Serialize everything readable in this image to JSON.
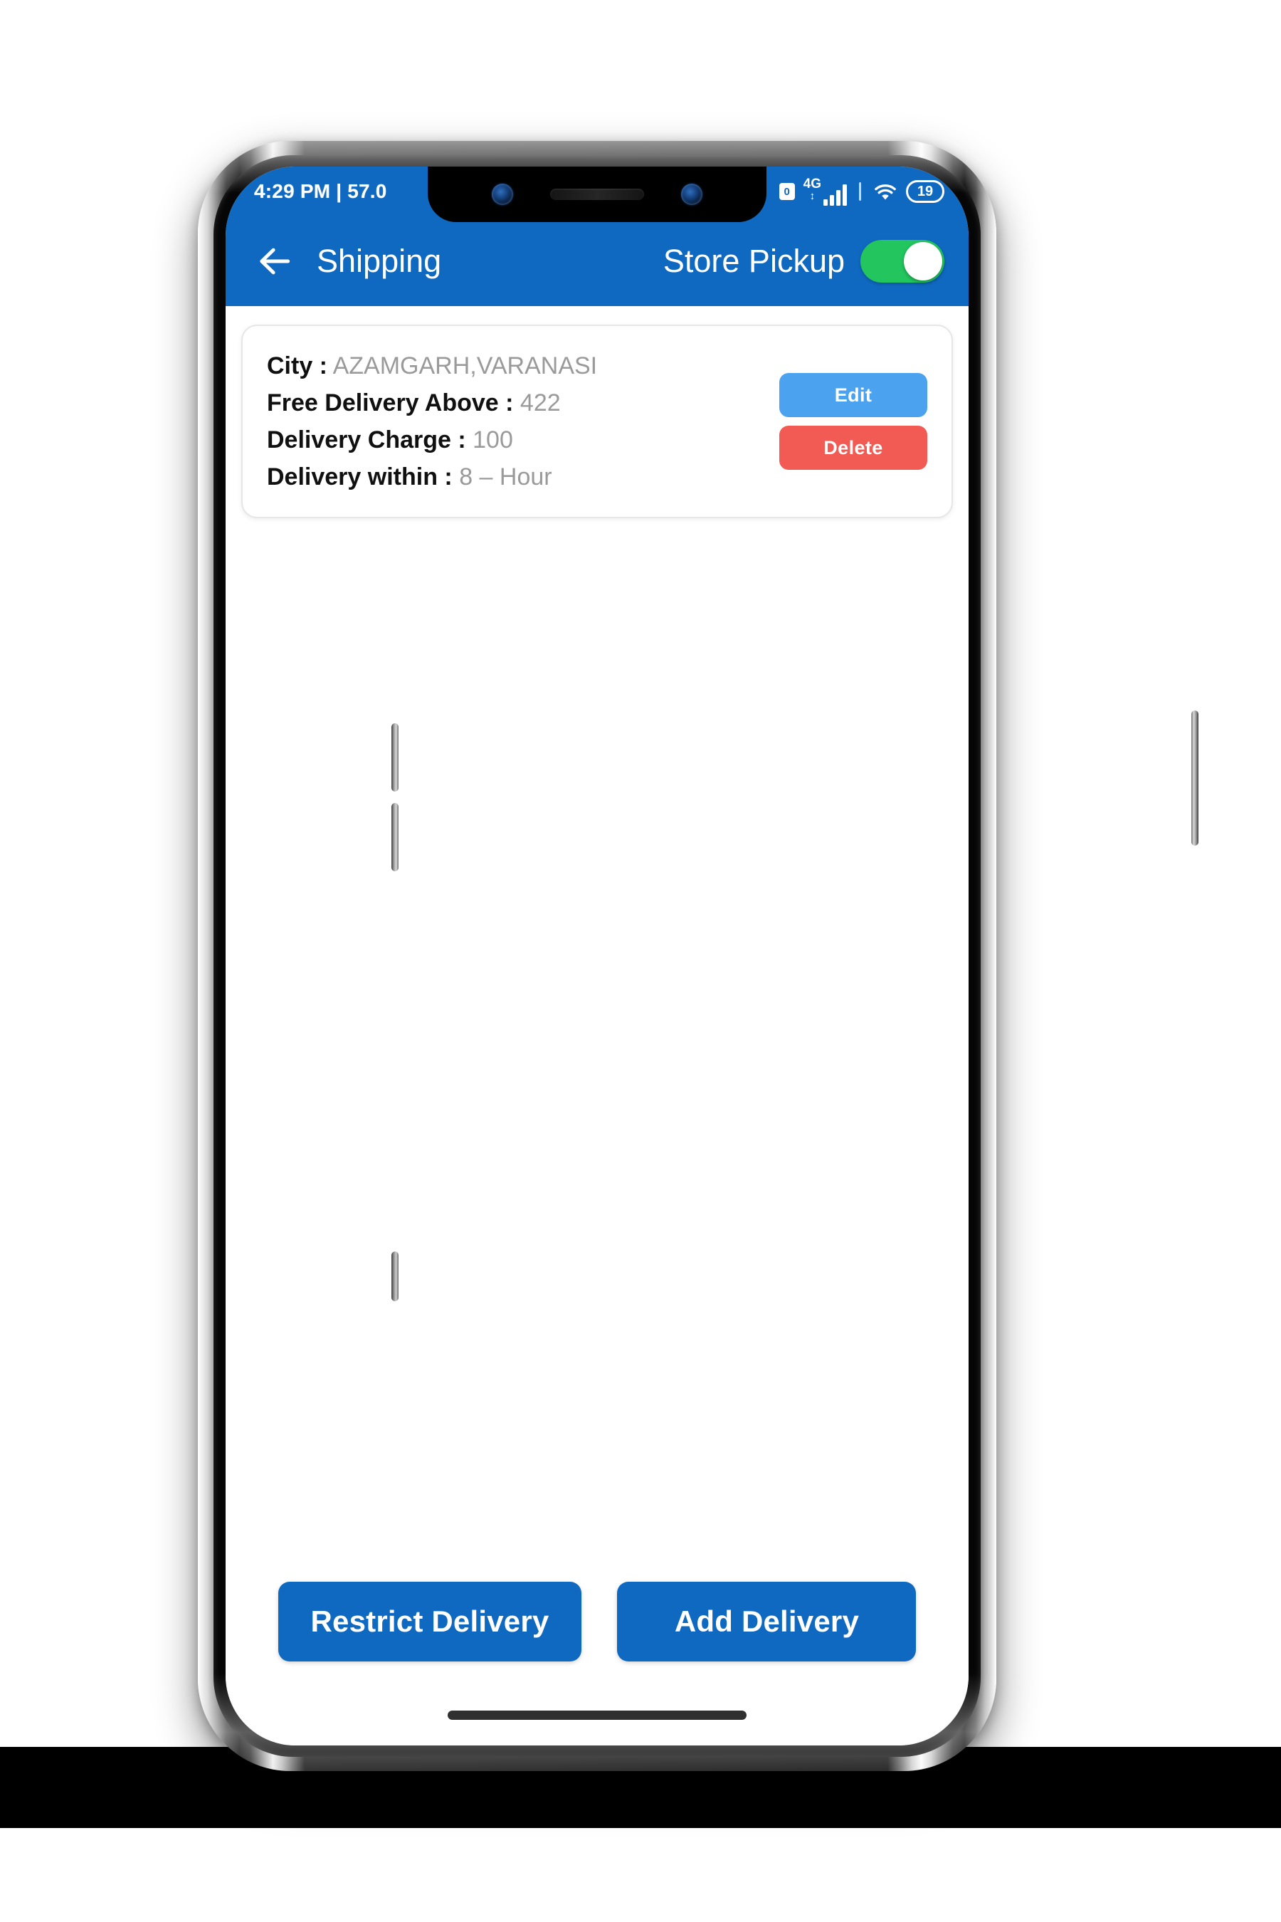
{
  "status_bar": {
    "left_text": "4:29 PM | 57.0",
    "alarm_icon": "alarm-clock-icon",
    "network_label": "4G",
    "data_arrows": "↕",
    "signal_icon": "signal-bars-icon",
    "wifi_icon": "wifi-icon",
    "battery_level": "19"
  },
  "header": {
    "back_icon": "arrow-left-icon",
    "title": "Shipping",
    "store_pickup_label": "Store Pickup",
    "store_pickup_on": true,
    "background_color": "#1069C0"
  },
  "delivery_card": {
    "rows": [
      {
        "key": "City :",
        "value": "AZAMGARH,VARANASI"
      },
      {
        "key": "Free Delivery Above :",
        "value": "422"
      },
      {
        "key": "Delivery Charge :",
        "value": "100"
      },
      {
        "key": "Delivery within :",
        "value": "8 – Hour"
      }
    ],
    "edit_label": "Edit",
    "delete_label": "Delete",
    "edit_color": "#4BA3F0",
    "delete_color": "#F15B53"
  },
  "bottom_actions": {
    "restrict_label": "Restrict Delivery",
    "add_label": "Add Delivery",
    "button_color": "#1069C0"
  }
}
